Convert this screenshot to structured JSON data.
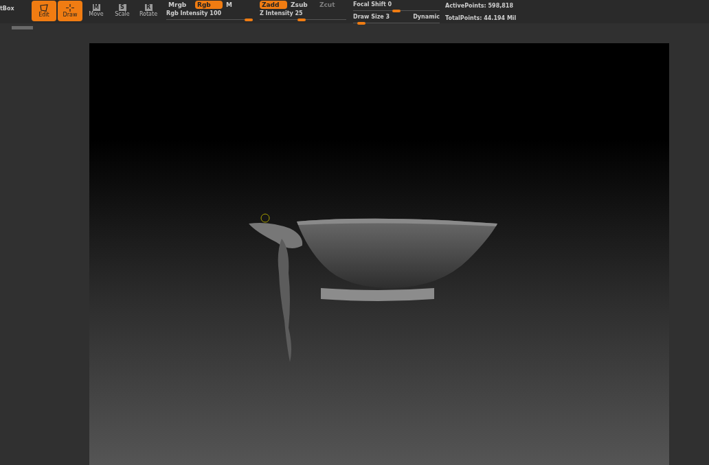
{
  "toolbar": {
    "palette_label": "tBox",
    "tools": [
      {
        "label": "Edit",
        "selected": true,
        "kind": "edit"
      },
      {
        "label": "Draw",
        "selected": true,
        "kind": "draw"
      },
      {
        "label": "Move",
        "selected": false,
        "kind": "move",
        "key": "M"
      },
      {
        "label": "Scale",
        "selected": false,
        "kind": "scale",
        "key": "S"
      },
      {
        "label": "Rotate",
        "selected": false,
        "kind": "rotate",
        "key": "R"
      }
    ],
    "rgb_modes": [
      {
        "label": "Mrgb",
        "selected": false
      },
      {
        "label": "Rgb",
        "selected": true
      },
      {
        "label": "M",
        "selected": false
      }
    ],
    "z_modes": [
      {
        "label": "Zadd",
        "selected": true,
        "disabled": false
      },
      {
        "label": "Zsub",
        "selected": false,
        "disabled": false
      },
      {
        "label": "Zcut",
        "selected": false,
        "disabled": true
      }
    ],
    "sliders": [
      {
        "label": "Rgb Intensity 100",
        "level": 1.0
      },
      {
        "label": "Z Intensity 25",
        "level": 0.48
      },
      {
        "label": "Focal Shift 0",
        "level": 0.5
      },
      {
        "label": "Draw Size 3",
        "level": 0.05,
        "badge": "Dynamic"
      }
    ],
    "stats": [
      "ActivePoints: 598,818",
      "TotalPoints: 44.194 Mil"
    ]
  }
}
